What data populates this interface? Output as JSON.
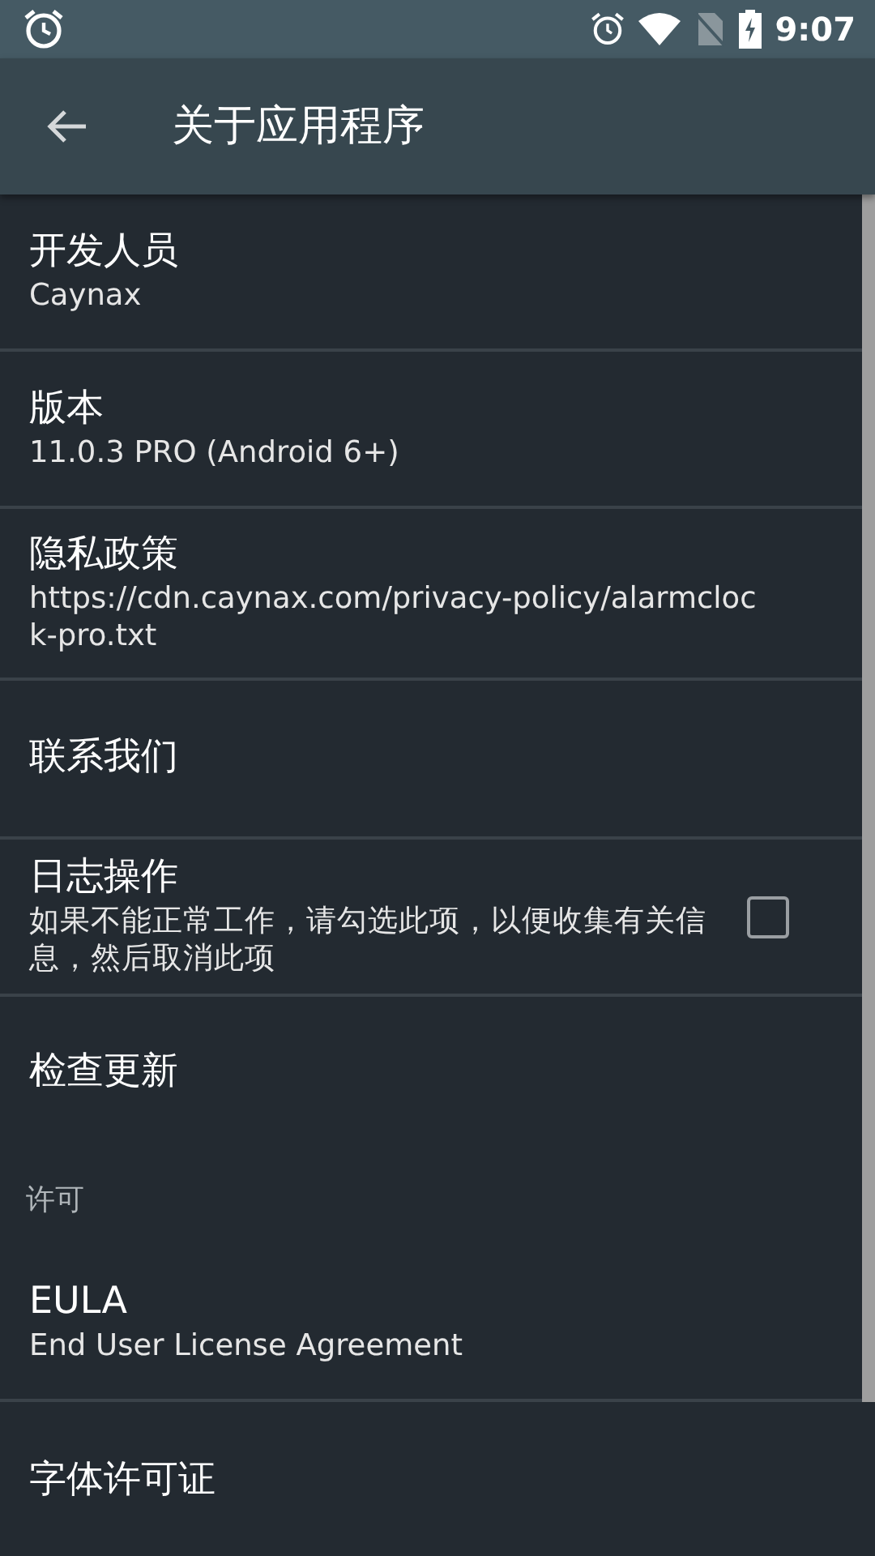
{
  "status_bar": {
    "time": "9:07"
  },
  "toolbar": {
    "title": "关于应用程序"
  },
  "items": [
    {
      "kind": "item",
      "title": "开发人员",
      "summary": "Caynax"
    },
    {
      "kind": "item",
      "title": "版本",
      "summary": "11.0.3 PRO (Android 6+)"
    },
    {
      "kind": "item",
      "title": "隐私政策",
      "summary": "https://cdn.caynax.com/privacy-policy/alarmclock-pro.txt"
    },
    {
      "kind": "item",
      "title": "联系我们"
    },
    {
      "kind": "checkbox",
      "title": "日志操作",
      "summary": "如果不能正常工作，请勾选此项，以便收集有关信息，然后取消此项",
      "checked": false
    },
    {
      "kind": "item",
      "title": "检查更新"
    },
    {
      "kind": "category",
      "title": "许可"
    },
    {
      "kind": "item",
      "title": "EULA",
      "summary": "End User License Agreement"
    },
    {
      "kind": "item",
      "title": "字体许可证"
    }
  ]
}
